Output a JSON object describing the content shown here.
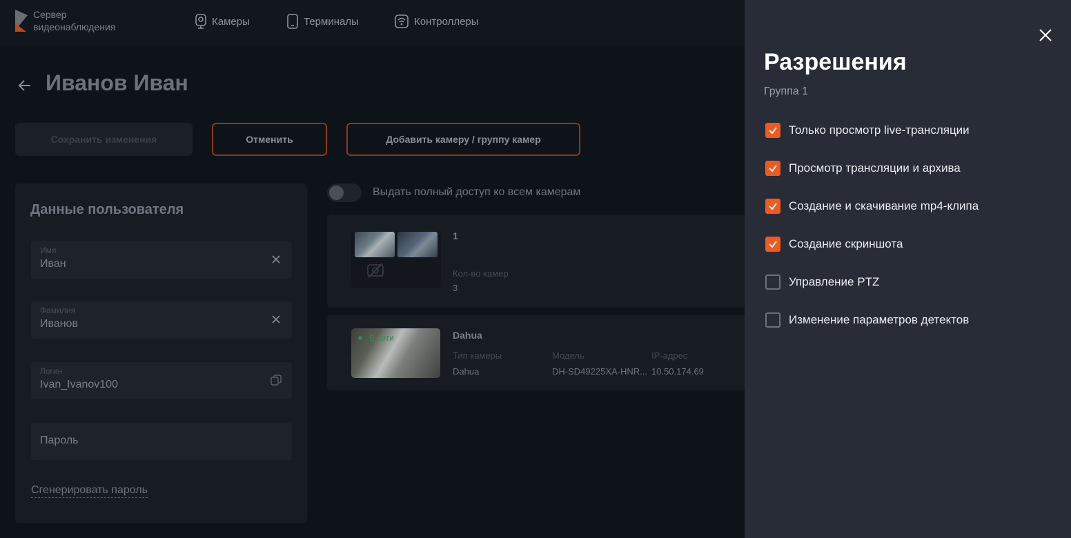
{
  "app": {
    "logo_line1": "Сервер",
    "logo_line2": "видеонаблюдения"
  },
  "nav": {
    "cameras": "Камеры",
    "terminals": "Терминалы",
    "controllers": "Контроллеры"
  },
  "page": {
    "title": "Иванов Иван"
  },
  "actions": {
    "save": "Сохранить изменения",
    "cancel": "Отменить",
    "add_camera": "Добавить камеру / группу камер"
  },
  "user_card": {
    "title": "Данные пользователя",
    "first_name_label": "Имя",
    "first_name_value": "Иван",
    "last_name_label": "Фамилия",
    "last_name_value": "Иванов",
    "login_label": "Логин",
    "login_value": "Ivan_Ivanov100",
    "password_placeholder": "Пароль",
    "generate_password": "Сгенерировать пароль"
  },
  "access": {
    "full_access_label": "Выдать полный доступ ко всем камерам",
    "full_access_on": false
  },
  "camera_list": [
    {
      "name": "1",
      "count_label": "Кол-во камер",
      "count_value": "3"
    },
    {
      "name": "Dahua",
      "status": "В сети",
      "type_label": "Тип камеры",
      "type_value": "Dahua",
      "model_label": "Модель",
      "model_value": "DH-SD49225XA-HNR...",
      "ip_label": "IP-адрес",
      "ip_value": "10.50.174.69"
    }
  ],
  "permissions_panel": {
    "title": "Разрешения",
    "subtitle": "Группа 1",
    "items": [
      {
        "label": "Только просмотр live-трансляции",
        "checked": true
      },
      {
        "label": "Просмотр трансляции и архива",
        "checked": true
      },
      {
        "label": "Создание и скачивание mp4-клипа",
        "checked": true
      },
      {
        "label": "Создание скриншота",
        "checked": true
      },
      {
        "label": "Управление PTZ",
        "checked": false
      },
      {
        "label": "Изменение параметров детектов",
        "checked": false
      }
    ]
  },
  "colors": {
    "accent": "#ef5a1f",
    "online": "#2e8a57",
    "panel_bg": "#272c37",
    "page_bg": "#0e1219"
  }
}
